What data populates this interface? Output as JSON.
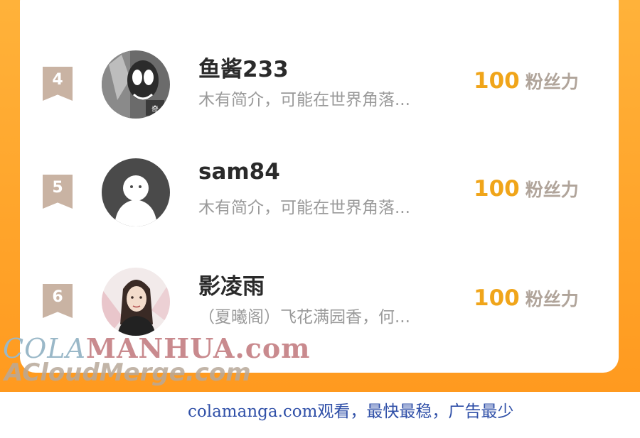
{
  "ranking": {
    "rows": [
      {
        "rank": "4",
        "nickname": "鱼酱233",
        "bio": "木有简介，可能在世界角落...",
        "score": "100",
        "unit": "粉丝力"
      },
      {
        "rank": "5",
        "nickname": "sam84",
        "bio": "木有简介，可能在世界角落...",
        "score": "100",
        "unit": "粉丝力"
      },
      {
        "rank": "6",
        "nickname": "影凌雨",
        "bio": "（夏曦阁）飞花满园香，何...",
        "score": "100",
        "unit": "粉丝力"
      }
    ]
  },
  "watermark": {
    "part_a": "COLA",
    "part_b": "MANHUA.com",
    "line2": "ACloudMerge.com"
  },
  "footer": {
    "text": "colamanga.com观看，最快最稳，广告最少"
  },
  "colors": {
    "frame": "#ff9a1f",
    "score": "#f0a51a",
    "badge": "#c9b3a3",
    "footer_text": "#3050a8"
  }
}
